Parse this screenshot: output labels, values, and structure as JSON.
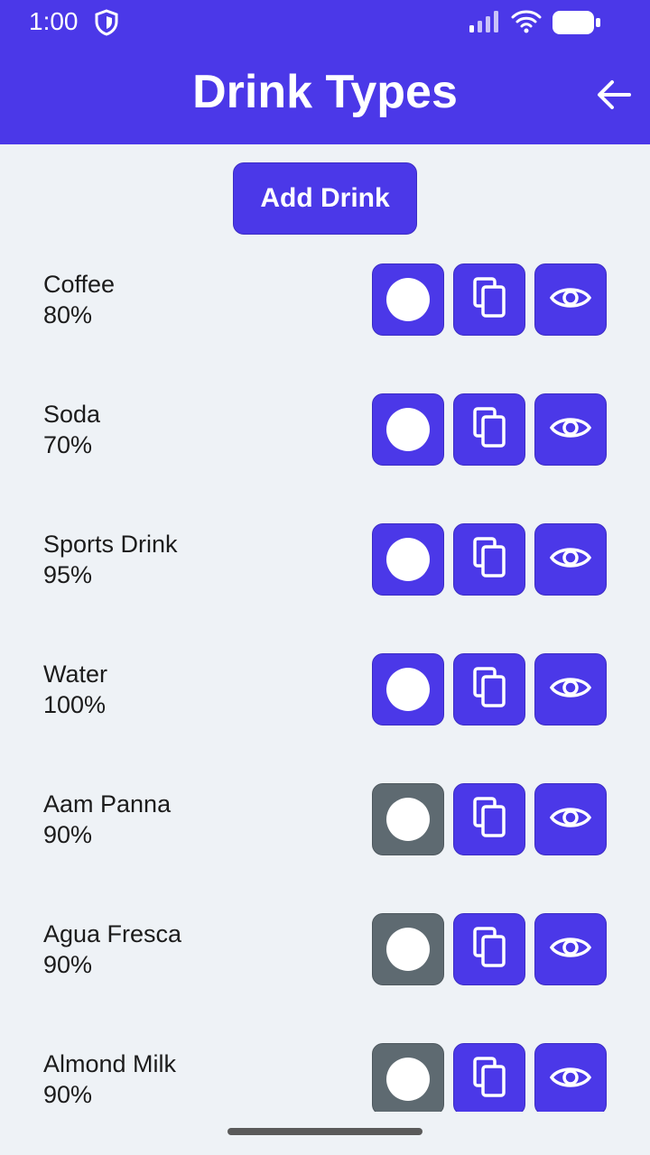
{
  "status_bar": {
    "time": "1:00"
  },
  "header": {
    "title": "Drink Types"
  },
  "actions": {
    "add_label": "Add Drink"
  },
  "drinks": [
    {
      "name": "Coffee",
      "percent": "80%",
      "enabled": true
    },
    {
      "name": "Soda",
      "percent": "70%",
      "enabled": true
    },
    {
      "name": "Sports Drink",
      "percent": "95%",
      "enabled": true
    },
    {
      "name": "Water",
      "percent": "100%",
      "enabled": true
    },
    {
      "name": "Aam Panna",
      "percent": "90%",
      "enabled": false
    },
    {
      "name": "Agua Fresca",
      "percent": "90%",
      "enabled": false
    },
    {
      "name": "Almond Milk",
      "percent": "90%",
      "enabled": false
    }
  ],
  "colors": {
    "accent": "#4b38e8",
    "disabled": "#5e6a71",
    "background": "#eef2f6"
  },
  "icons": {
    "status": [
      "shield-icon",
      "signal-icon",
      "wifi-icon",
      "battery-icon"
    ],
    "header": "arrow-left-icon",
    "row_buttons": [
      "toggle-circle-icon",
      "copy-icon",
      "eye-icon"
    ]
  }
}
